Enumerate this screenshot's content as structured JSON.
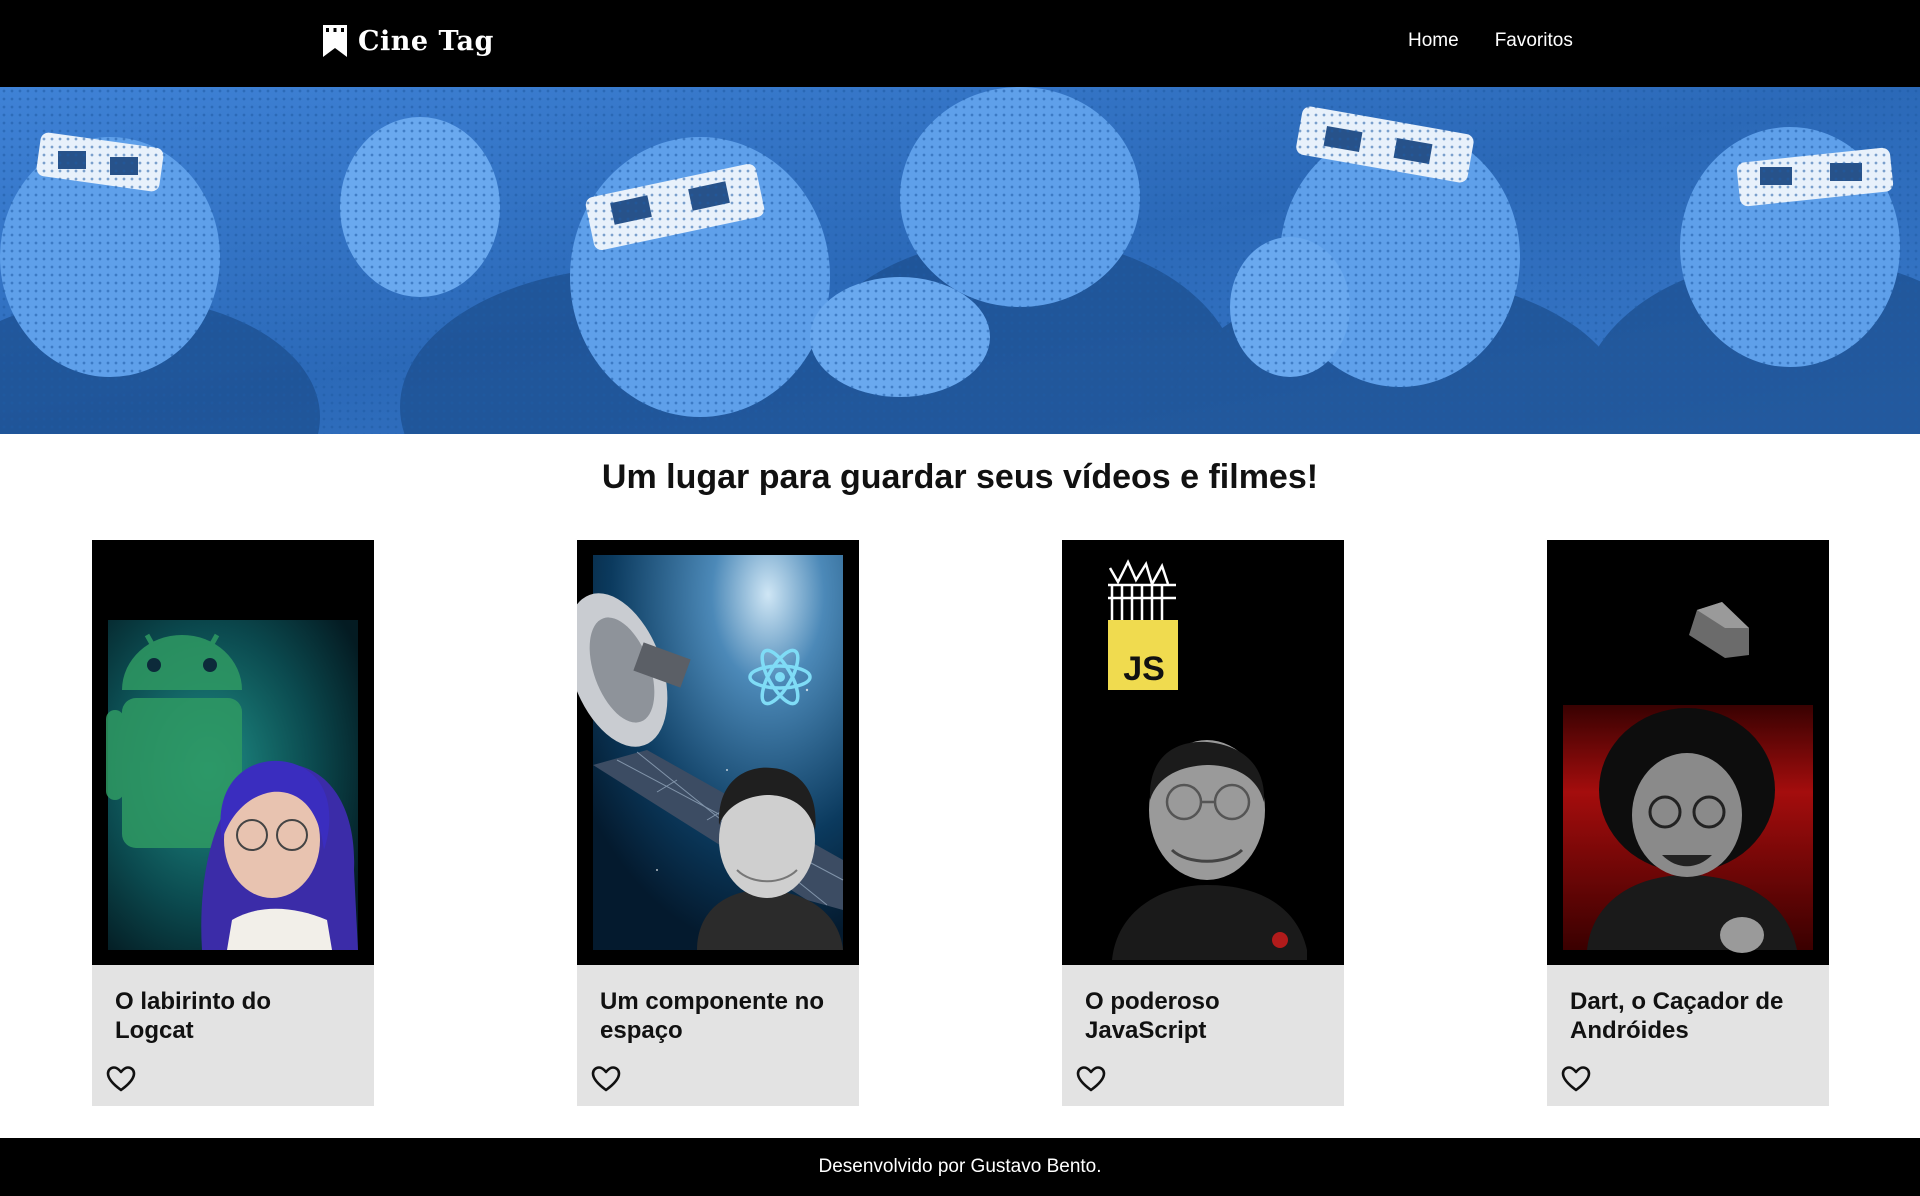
{
  "header": {
    "brand": "Cine Tag",
    "nav": [
      {
        "label": "Home"
      },
      {
        "label": "Favoritos"
      }
    ]
  },
  "main": {
    "title": "Um lugar para guardar seus vídeos e filmes!",
    "cards": [
      {
        "title": "O labirinto do Logcat",
        "favorite": false,
        "poster_icon": "android-robot-icon"
      },
      {
        "title": "Um componente no espaço",
        "favorite": false,
        "poster_icon": "react-atom-icon"
      },
      {
        "title": "O poderoso JavaScript",
        "favorite": false,
        "poster_icon": "javascript-logo-icon",
        "poster_badge": "JS"
      },
      {
        "title": "Dart, o Caçador de Andróides",
        "favorite": false,
        "poster_icon": "dart-logo-icon"
      }
    ]
  },
  "footer": {
    "text": "Desenvolvido por Gustavo Bento."
  },
  "colors": {
    "header_bg": "#000000",
    "banner_tint": "#2e6fc1",
    "card_info_bg": "#e3e3e3",
    "js_yellow": "#f0db4f",
    "react_cyan": "#61dafb"
  }
}
